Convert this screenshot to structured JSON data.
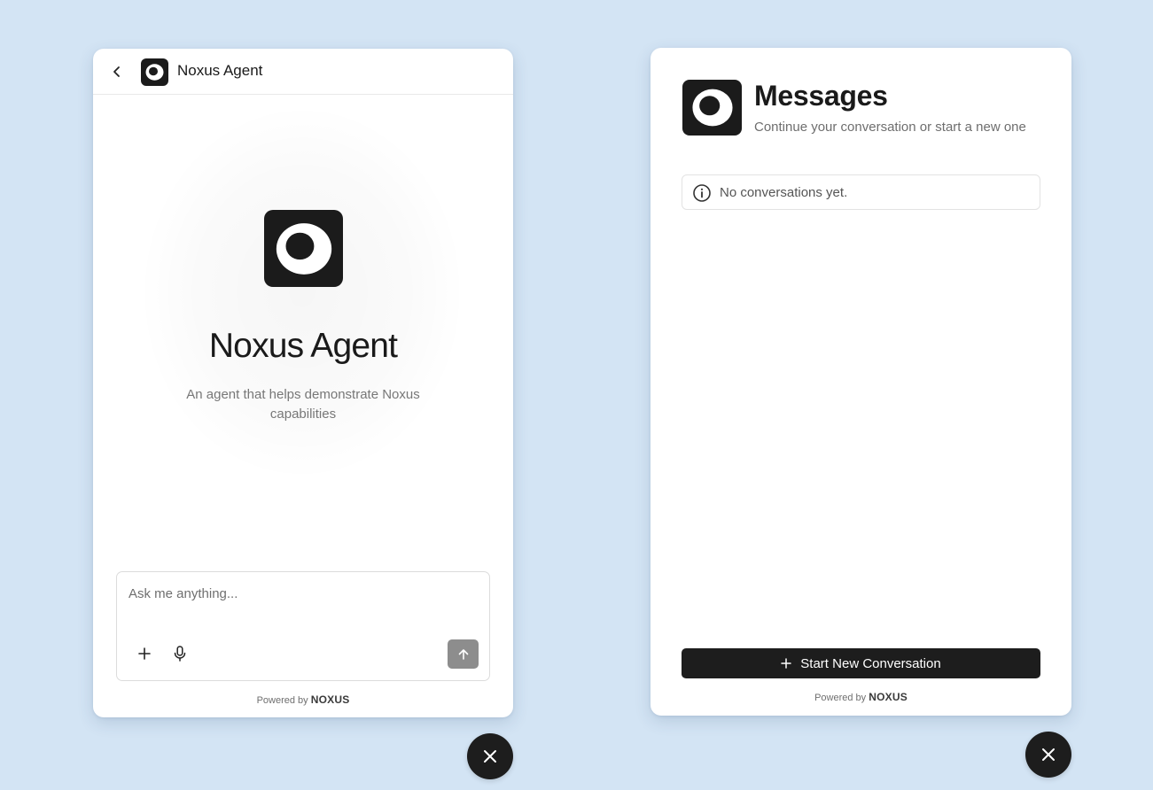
{
  "chat": {
    "header_title": "Noxus Agent",
    "hero_title": "Noxus Agent",
    "hero_description": "An agent that helps demonstrate Noxus capabilities",
    "composer_placeholder": "Ask me anything...",
    "powered_prefix": "Powered by",
    "powered_brand": "NOXUS"
  },
  "messages": {
    "title": "Messages",
    "subtitle": "Continue your conversation or start a new one",
    "empty_state": "No conversations yet.",
    "start_button_label": "Start New Conversation",
    "powered_prefix": "Powered by",
    "powered_brand": "NOXUS"
  },
  "icons": {
    "back": "chevron-left-icon",
    "logo": "noxus-logo",
    "attach": "plus-icon",
    "mic": "microphone-icon",
    "send": "arrow-up-icon",
    "info": "info-icon",
    "close": "close-icon"
  },
  "colors": {
    "background": "#d3e4f4",
    "panel": "#ffffff",
    "primary": "#1d1d1d",
    "send_button": "#8d8d8d",
    "muted_text": "#777777"
  }
}
